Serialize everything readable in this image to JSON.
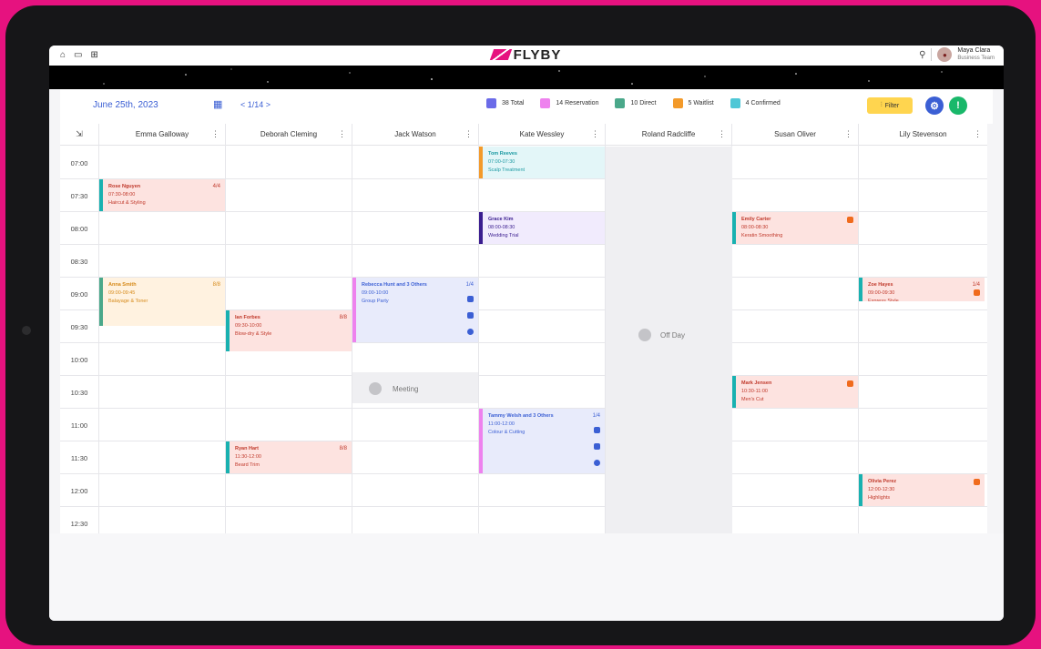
{
  "brand": "FLYBY",
  "user": {
    "name": "Maya Clara",
    "role": "Business Team"
  },
  "toolbar": {
    "date": "June 25th, 2023",
    "pager": "< 1/14 >",
    "filter_label": "Filter",
    "legend": [
      {
        "label": "38 Total",
        "color": "#6b6be8"
      },
      {
        "label": "14 Reservation",
        "color": "#ee82ee"
      },
      {
        "label": "10 Direct",
        "color": "#4aa88a"
      },
      {
        "label": "5 Waitlist",
        "color": "#f39a2a"
      },
      {
        "label": "4 Confirmed",
        "color": "#4fc7d6"
      }
    ]
  },
  "staff": [
    "Emma Galloway",
    "Deborah Cleming",
    "Jack Watson",
    "Kate Wessley",
    "Roland Radcliffe",
    "Susan Oliver",
    "Lily Stevenson"
  ],
  "times": [
    "07:00",
    "07:30",
    "08:00",
    "08:30",
    "09:00",
    "09:30",
    "10:00",
    "10:30",
    "11:00",
    "11:30",
    "12:00",
    "12:30"
  ],
  "off_day_label": "Off Day",
  "meeting_label": "Meeting",
  "events": [
    {
      "lines": [
        "Rose Nguyen",
        "07:30-08:00",
        "Haircut & Styling"
      ],
      "flag": "4/4",
      "text": "#c0392b",
      "bg": "#fde3e0",
      "bar": "#19b1b0"
    },
    {
      "lines": [
        "Anna Smith",
        "09:00-09:45",
        "Balayage & Toner"
      ],
      "flag": "8/8",
      "text": "#d68a1a",
      "bg": "#fff2e0",
      "bar": "#4aa88a"
    },
    {
      "lines": [
        "Ian Forbes",
        "09:30-10:00",
        "Blow-dry & Style"
      ],
      "flag": "8/8",
      "text": "#c0392b",
      "bg": "#fde3e0",
      "bar": "#19b1b0"
    },
    {
      "lines": [
        "Ryan Hart",
        "11:30-12:00",
        "Beard Trim"
      ],
      "flag": "8/8",
      "text": "#c0392b",
      "bg": "#fde3e0",
      "bar": "#19b1b0"
    },
    {
      "lines": [
        "Rebecca Hunt and 3 Others",
        "09:00-10:00",
        "Group Party"
      ],
      "flag": "1/4",
      "text": "#3b5fd4",
      "bg": "#e8ebfb",
      "bar": "#ee82ee"
    },
    {
      "lines": [
        "Tom Reeves",
        "07:00-07:30",
        "Scalp Treatment"
      ],
      "flag": "",
      "text": "#1d9aa3",
      "bg": "#e3f6f8",
      "bar": "#f39a2a"
    },
    {
      "lines": [
        "Grace Kim",
        "08:00-08:30",
        "Wedding Trial"
      ],
      "flag": "",
      "text": "#3a1d8f",
      "bg": "#f1ebfd",
      "bar": "#3a1d8f"
    },
    {
      "lines": [
        "Tammy Welsh and 3 Others",
        "11:00-12:00",
        "Colour & Cutting"
      ],
      "flag": "1/4",
      "text": "#3b5fd4",
      "bg": "#e8ebfb",
      "bar": "#ee82ee"
    },
    {
      "lines": [
        "Emily Carter",
        "08:00-08:30",
        "Keratin Smoothing"
      ],
      "flag": "",
      "text": "#c0392b",
      "bg": "#fde3e0",
      "bar": "#19b1b0"
    },
    {
      "lines": [
        "Mark Jensen",
        "10:30-11:00",
        "Men's Cut"
      ],
      "flag": "",
      "text": "#c0392b",
      "bg": "#fde3e0",
      "bar": "#19b1b0"
    },
    {
      "lines": [
        "Zoe Hayes",
        "09:00-09:30",
        "Express Style"
      ],
      "flag": "1/4",
      "text": "#c0392b",
      "bg": "#fde3e0",
      "bar": "#19b1b0"
    },
    {
      "lines": [
        "Olivia Perez",
        "12:00-12:30",
        "Highlights"
      ],
      "flag": "",
      "text": "#c0392b",
      "bg": "#fde3e0",
      "bar": "#19b1b0"
    }
  ]
}
